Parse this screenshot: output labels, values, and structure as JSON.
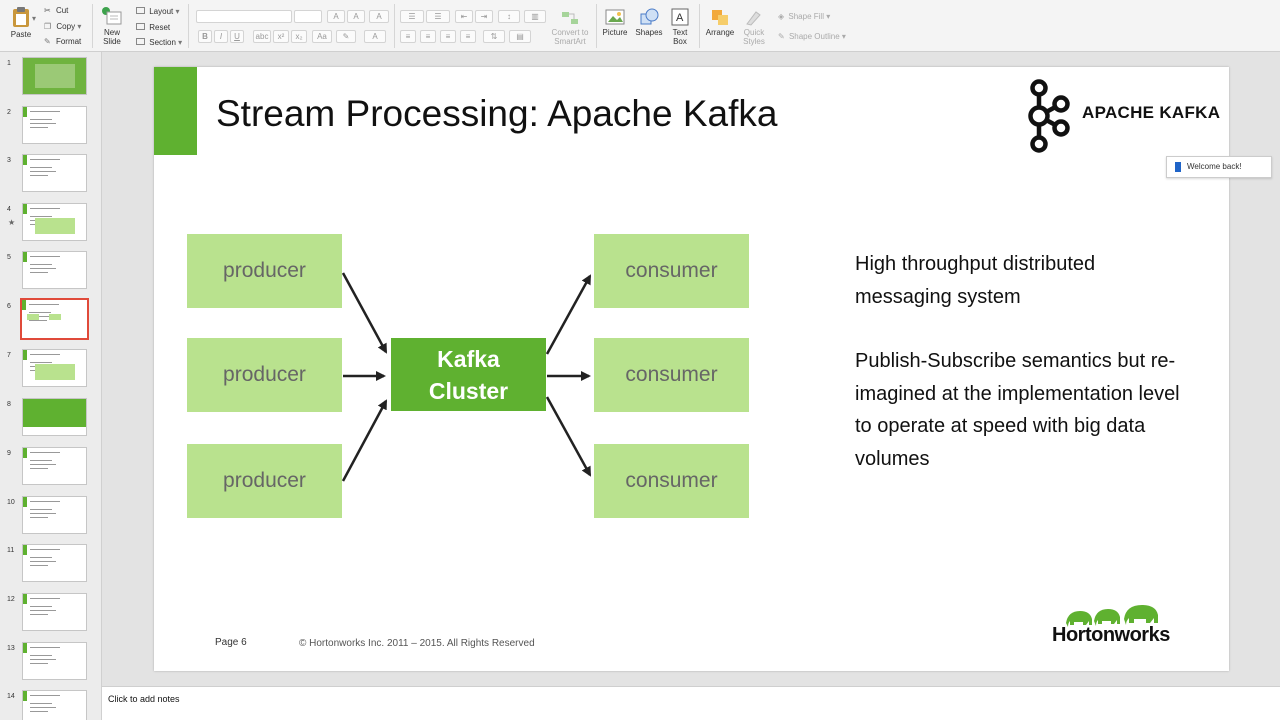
{
  "ribbon": {
    "paste": "Paste",
    "cut": "Cut",
    "copy": "Copy",
    "format": "Format",
    "new_slide": "New Slide",
    "layout": "Layout",
    "reset": "Reset",
    "section": "Section",
    "convert_smartart": "Convert to SmartArt",
    "picture": "Picture",
    "shapes": "Shapes",
    "text_box": "Text Box",
    "arrange": "Arrange",
    "quick_styles": "Quick Styles",
    "shape_fill": "Shape Fill",
    "shape_outline": "Shape Outline"
  },
  "thumbnails": {
    "numbers": [
      "1",
      "2",
      "3",
      "4",
      "5",
      "6",
      "7",
      "8",
      "9",
      "10",
      "11",
      "12",
      "13",
      "14"
    ],
    "selected": "6",
    "star": "★"
  },
  "slide": {
    "title": "Stream Processing: Apache Kafka",
    "producers": [
      "producer",
      "producer",
      "producer"
    ],
    "consumers": [
      "consumer",
      "consumer",
      "consumer"
    ],
    "cluster_line1": "Kafka",
    "cluster_line2": "Cluster",
    "desc1": "High throughput distributed messaging system",
    "desc2": "Publish-Subscribe semantics but re-imagined at the implementation level to operate at speed with big data volumes",
    "page": "Page 6",
    "copyright": "© Hortonworks Inc. 2011 – 2015. All Rights Reserved",
    "kafka_logo_text": "APACHE KAFKA",
    "hortonworks_logo_text": "Hortonworks"
  },
  "toast": {
    "label": "Welcome back!"
  },
  "notes": {
    "placeholder": "Click to add notes"
  },
  "colors": {
    "accent_green": "#5fb130",
    "light_green": "#b9e28e",
    "selection_red": "#e04a3a"
  }
}
